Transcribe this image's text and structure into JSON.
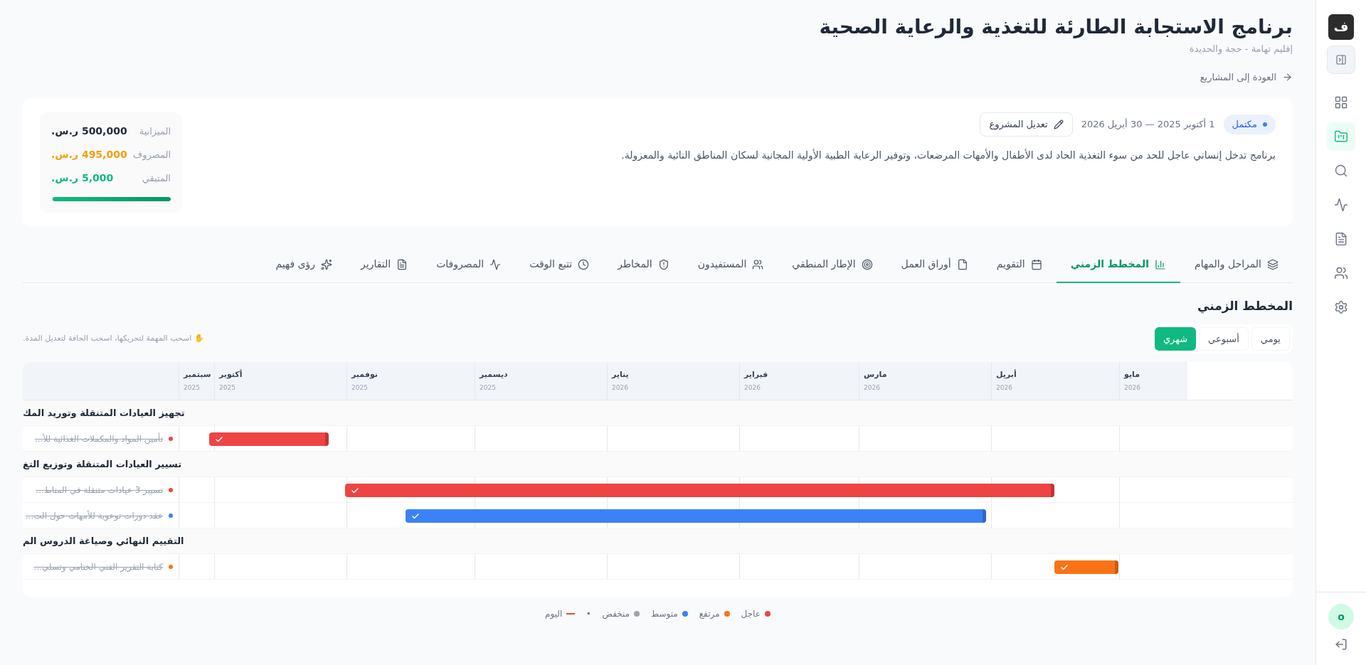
{
  "sidebar": {
    "logo": "ف",
    "items": [
      {
        "kind": "collapse",
        "selected": false
      },
      {
        "kind": "grid",
        "selected": false
      },
      {
        "kind": "folder",
        "selected": true
      },
      {
        "kind": "search",
        "selected": false
      },
      {
        "kind": "activity",
        "selected": false
      },
      {
        "kind": "file",
        "selected": false
      },
      {
        "kind": "users",
        "selected": false
      },
      {
        "kind": "settings",
        "selected": false
      }
    ],
    "avatar": "o"
  },
  "header": {
    "title": "برنامج الاستجابة الطارئة للتغذية والرعاية الصحية",
    "subtitle": "إقليم تهامة - حجة والحديدة",
    "back_link": "العودة إلى المشاريع"
  },
  "project": {
    "status": "مكتمل",
    "dates": "1 أكتوبر 2025 — 30 أبريل 2026",
    "edit_button": "تعديل المشروع",
    "description": "برنامج تدخل إنساني عاجل للحد من سوء التغذية الحاد لدى الأطفال والأمهات المرضعات، وتوفير الرعاية الطبية الأولية المجانية لسكان المناطق النائية والمعزولة.",
    "budget": [
      {
        "label": "الميزانية",
        "value": "500,000 ر.س.",
        "color": "#1f2937"
      },
      {
        "label": "المصروف",
        "value": "495,000 ر.س.",
        "color": "#f59e0b"
      },
      {
        "label": "المتبقي",
        "value": "5,000 ر.س.",
        "color": "#10b981"
      }
    ],
    "budget_bar": {
      "level": 0.99
    }
  },
  "tabs": [
    {
      "label": "المراحل والمهام",
      "kind": "layers",
      "selected": false
    },
    {
      "label": "المخطط الزمني",
      "kind": "chart",
      "selected": true
    },
    {
      "label": "التقويم",
      "kind": "calendar",
      "selected": false
    },
    {
      "label": "أوراق العمل",
      "kind": "file",
      "selected": false
    },
    {
      "label": "الإطار المنطقي",
      "kind": "target",
      "selected": false
    },
    {
      "label": "المستفيدون",
      "kind": "users",
      "selected": false
    },
    {
      "label": "المخاطر",
      "kind": "shield",
      "selected": false
    },
    {
      "label": "تتبع الوقت",
      "kind": "clock",
      "selected": false
    },
    {
      "label": "المصروفات",
      "kind": "activity",
      "selected": false
    },
    {
      "label": "التقارير",
      "kind": "report",
      "selected": false
    },
    {
      "label": "رؤى فهيم",
      "kind": "sparkles",
      "selected": false
    }
  ],
  "timeline": {
    "title": "المخطط الزمني",
    "views": [
      {
        "label": "يومي",
        "selected": false
      },
      {
        "label": "أسبوعي",
        "selected": false
      },
      {
        "label": "شهري",
        "selected": true
      }
    ],
    "hint": "✋ اسحب المهمة لتحريكها، اسحب الحافة لتعديل المدة.",
    "months": [
      {
        "name": "مايو",
        "year": "2026"
      },
      {
        "name": "أبريل",
        "year": "2026"
      },
      {
        "name": "مارس",
        "year": "2026"
      },
      {
        "name": "فبراير",
        "year": "2026"
      },
      {
        "name": "يناير",
        "year": "2026"
      },
      {
        "name": "ديسمبر",
        "year": "2025"
      },
      {
        "name": "نوفمبر",
        "year": "2025"
      },
      {
        "name": "أكتوبر",
        "year": "2025"
      },
      {
        "name": "سبتمبر",
        "year": "2025"
      }
    ],
    "groups": [
      {
        "name": "تجهيز العيادات المتنقلة وتوريد المك",
        "tasks": [
          {
            "name": "تأمين المواد والمكملات الغذائية للأ...",
            "color": "#ef4444",
            "done": true
          }
        ]
      },
      {
        "name": "تسيير العيادات المتنقلة وتوزيع التغ",
        "tasks": [
          {
            "name": "تسيير 3 عيادات متنقلة في المناط...",
            "color": "#ef4444",
            "done": true
          },
          {
            "name": "عقد دورات توعوية للأمهات حول الت...",
            "color": "#3b82f6",
            "done": true
          }
        ]
      },
      {
        "name": "التقييم النهائي وصياغة الدروس الم",
        "tasks": [
          {
            "name": "كتابة التقرير الفني الختامي وتسلي...",
            "color": "#f97316",
            "done": true
          }
        ]
      }
    ]
  },
  "legend": {
    "items": [
      {
        "label": "عاجل",
        "color": "#ef4444"
      },
      {
        "label": "مرتفع",
        "color": "#f97316"
      },
      {
        "label": "متوسط",
        "color": "#3b82f6"
      },
      {
        "label": "منخفض",
        "color": "#9ca3af"
      }
    ],
    "separator": "·",
    "today": "اليوم"
  }
}
